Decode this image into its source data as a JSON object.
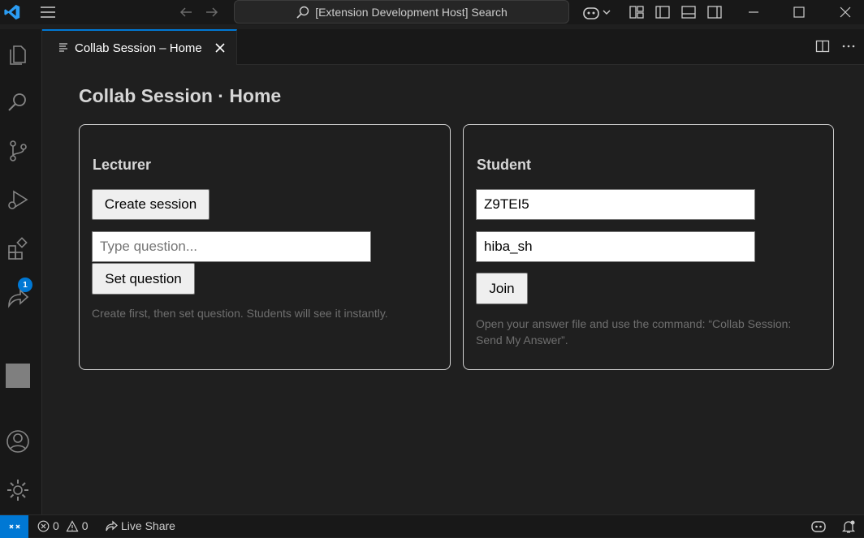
{
  "titlebar": {
    "search_text": "[Extension Development Host] Search"
  },
  "tab": {
    "label": "Collab Session – Home"
  },
  "page": {
    "title": "Collab Session · Home"
  },
  "lecturer": {
    "heading": "Lecturer",
    "create_label": "Create session",
    "question_placeholder": "Type question...",
    "question_value": "",
    "set_label": "Set question",
    "hint": "Create first, then set question. Students will see it instantly."
  },
  "student": {
    "heading": "Student",
    "session_code": "Z9TEI5",
    "username": "hiba_sh",
    "join_label": "Join",
    "hint": "Open your answer file and use the command: “Collab Session: Send My Answer”."
  },
  "activitybar": {
    "extensions_badge": "1"
  },
  "statusbar": {
    "errors": "0",
    "warnings": "0",
    "live_share": "Live Share"
  },
  "colors": {
    "accent": "#0078d4",
    "background": "#1f1f1f",
    "chrome": "#181818"
  },
  "icons": [
    "vscode-logo-icon",
    "menu-icon",
    "arrow-left-icon",
    "arrow-right-icon",
    "search-icon",
    "copilot-icon",
    "layout-icon",
    "toggle-sidebar-icon",
    "toggle-panel-icon",
    "toggle-secondary-sidebar-icon",
    "minimize-icon",
    "maximize-icon",
    "close-icon",
    "explorer-icon",
    "search-view-icon",
    "source-control-icon",
    "run-debug-icon",
    "extensions-icon",
    "live-share-icon",
    "accounts-icon",
    "settings-gear-icon",
    "split-editor-icon",
    "more-actions-icon",
    "remote-icon",
    "error-icon",
    "warning-icon",
    "bell-icon"
  ]
}
